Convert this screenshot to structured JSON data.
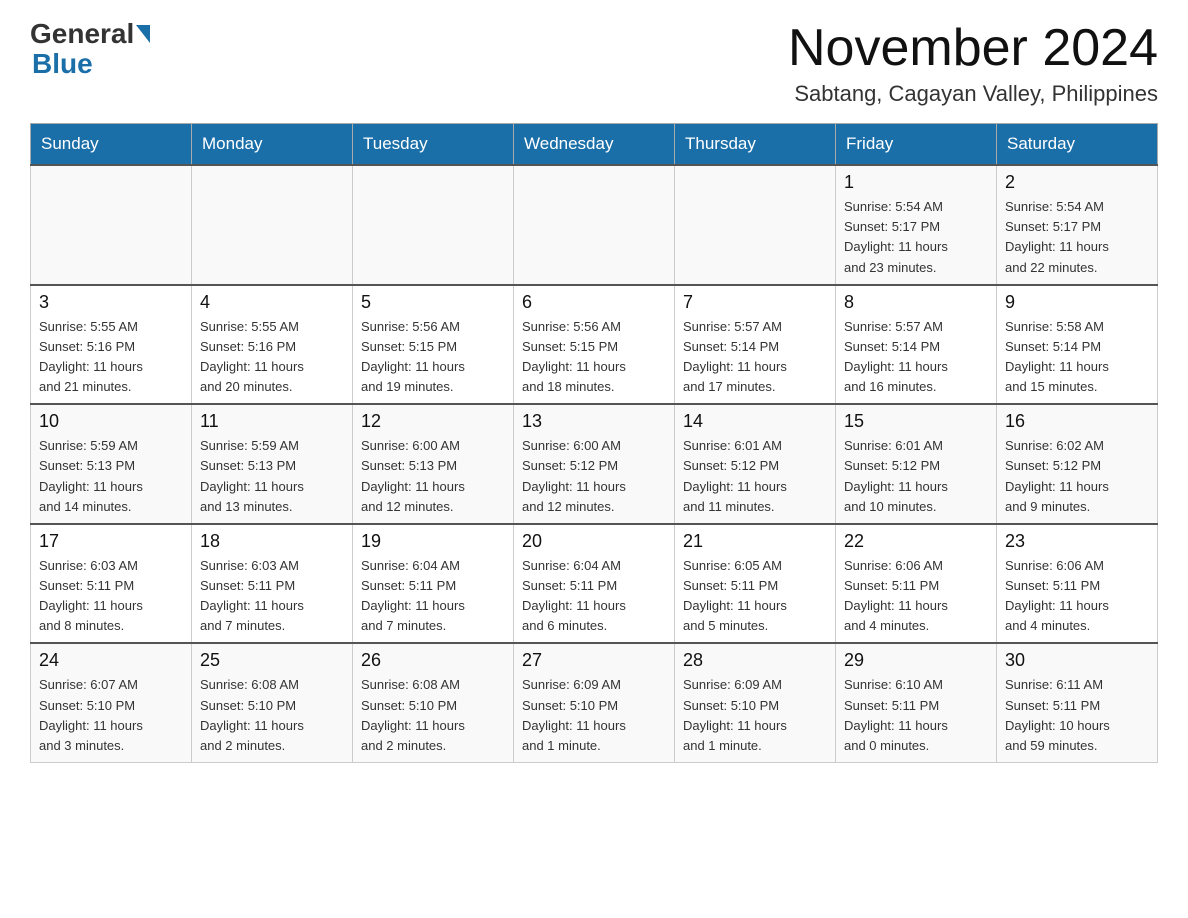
{
  "header": {
    "logo_general": "General",
    "logo_blue": "Blue",
    "month_title": "November 2024",
    "location": "Sabtang, Cagayan Valley, Philippines"
  },
  "days_of_week": [
    "Sunday",
    "Monday",
    "Tuesday",
    "Wednesday",
    "Thursday",
    "Friday",
    "Saturday"
  ],
  "weeks": [
    {
      "days": [
        {
          "date": "",
          "info": ""
        },
        {
          "date": "",
          "info": ""
        },
        {
          "date": "",
          "info": ""
        },
        {
          "date": "",
          "info": ""
        },
        {
          "date": "",
          "info": ""
        },
        {
          "date": "1",
          "info": "Sunrise: 5:54 AM\nSunset: 5:17 PM\nDaylight: 11 hours\nand 23 minutes."
        },
        {
          "date": "2",
          "info": "Sunrise: 5:54 AM\nSunset: 5:17 PM\nDaylight: 11 hours\nand 22 minutes."
        }
      ]
    },
    {
      "days": [
        {
          "date": "3",
          "info": "Sunrise: 5:55 AM\nSunset: 5:16 PM\nDaylight: 11 hours\nand 21 minutes."
        },
        {
          "date": "4",
          "info": "Sunrise: 5:55 AM\nSunset: 5:16 PM\nDaylight: 11 hours\nand 20 minutes."
        },
        {
          "date": "5",
          "info": "Sunrise: 5:56 AM\nSunset: 5:15 PM\nDaylight: 11 hours\nand 19 minutes."
        },
        {
          "date": "6",
          "info": "Sunrise: 5:56 AM\nSunset: 5:15 PM\nDaylight: 11 hours\nand 18 minutes."
        },
        {
          "date": "7",
          "info": "Sunrise: 5:57 AM\nSunset: 5:14 PM\nDaylight: 11 hours\nand 17 minutes."
        },
        {
          "date": "8",
          "info": "Sunrise: 5:57 AM\nSunset: 5:14 PM\nDaylight: 11 hours\nand 16 minutes."
        },
        {
          "date": "9",
          "info": "Sunrise: 5:58 AM\nSunset: 5:14 PM\nDaylight: 11 hours\nand 15 minutes."
        }
      ]
    },
    {
      "days": [
        {
          "date": "10",
          "info": "Sunrise: 5:59 AM\nSunset: 5:13 PM\nDaylight: 11 hours\nand 14 minutes."
        },
        {
          "date": "11",
          "info": "Sunrise: 5:59 AM\nSunset: 5:13 PM\nDaylight: 11 hours\nand 13 minutes."
        },
        {
          "date": "12",
          "info": "Sunrise: 6:00 AM\nSunset: 5:13 PM\nDaylight: 11 hours\nand 12 minutes."
        },
        {
          "date": "13",
          "info": "Sunrise: 6:00 AM\nSunset: 5:12 PM\nDaylight: 11 hours\nand 12 minutes."
        },
        {
          "date": "14",
          "info": "Sunrise: 6:01 AM\nSunset: 5:12 PM\nDaylight: 11 hours\nand 11 minutes."
        },
        {
          "date": "15",
          "info": "Sunrise: 6:01 AM\nSunset: 5:12 PM\nDaylight: 11 hours\nand 10 minutes."
        },
        {
          "date": "16",
          "info": "Sunrise: 6:02 AM\nSunset: 5:12 PM\nDaylight: 11 hours\nand 9 minutes."
        }
      ]
    },
    {
      "days": [
        {
          "date": "17",
          "info": "Sunrise: 6:03 AM\nSunset: 5:11 PM\nDaylight: 11 hours\nand 8 minutes."
        },
        {
          "date": "18",
          "info": "Sunrise: 6:03 AM\nSunset: 5:11 PM\nDaylight: 11 hours\nand 7 minutes."
        },
        {
          "date": "19",
          "info": "Sunrise: 6:04 AM\nSunset: 5:11 PM\nDaylight: 11 hours\nand 7 minutes."
        },
        {
          "date": "20",
          "info": "Sunrise: 6:04 AM\nSunset: 5:11 PM\nDaylight: 11 hours\nand 6 minutes."
        },
        {
          "date": "21",
          "info": "Sunrise: 6:05 AM\nSunset: 5:11 PM\nDaylight: 11 hours\nand 5 minutes."
        },
        {
          "date": "22",
          "info": "Sunrise: 6:06 AM\nSunset: 5:11 PM\nDaylight: 11 hours\nand 4 minutes."
        },
        {
          "date": "23",
          "info": "Sunrise: 6:06 AM\nSunset: 5:11 PM\nDaylight: 11 hours\nand 4 minutes."
        }
      ]
    },
    {
      "days": [
        {
          "date": "24",
          "info": "Sunrise: 6:07 AM\nSunset: 5:10 PM\nDaylight: 11 hours\nand 3 minutes."
        },
        {
          "date": "25",
          "info": "Sunrise: 6:08 AM\nSunset: 5:10 PM\nDaylight: 11 hours\nand 2 minutes."
        },
        {
          "date": "26",
          "info": "Sunrise: 6:08 AM\nSunset: 5:10 PM\nDaylight: 11 hours\nand 2 minutes."
        },
        {
          "date": "27",
          "info": "Sunrise: 6:09 AM\nSunset: 5:10 PM\nDaylight: 11 hours\nand 1 minute."
        },
        {
          "date": "28",
          "info": "Sunrise: 6:09 AM\nSunset: 5:10 PM\nDaylight: 11 hours\nand 1 minute."
        },
        {
          "date": "29",
          "info": "Sunrise: 6:10 AM\nSunset: 5:11 PM\nDaylight: 11 hours\nand 0 minutes."
        },
        {
          "date": "30",
          "info": "Sunrise: 6:11 AM\nSunset: 5:11 PM\nDaylight: 10 hours\nand 59 minutes."
        }
      ]
    }
  ]
}
